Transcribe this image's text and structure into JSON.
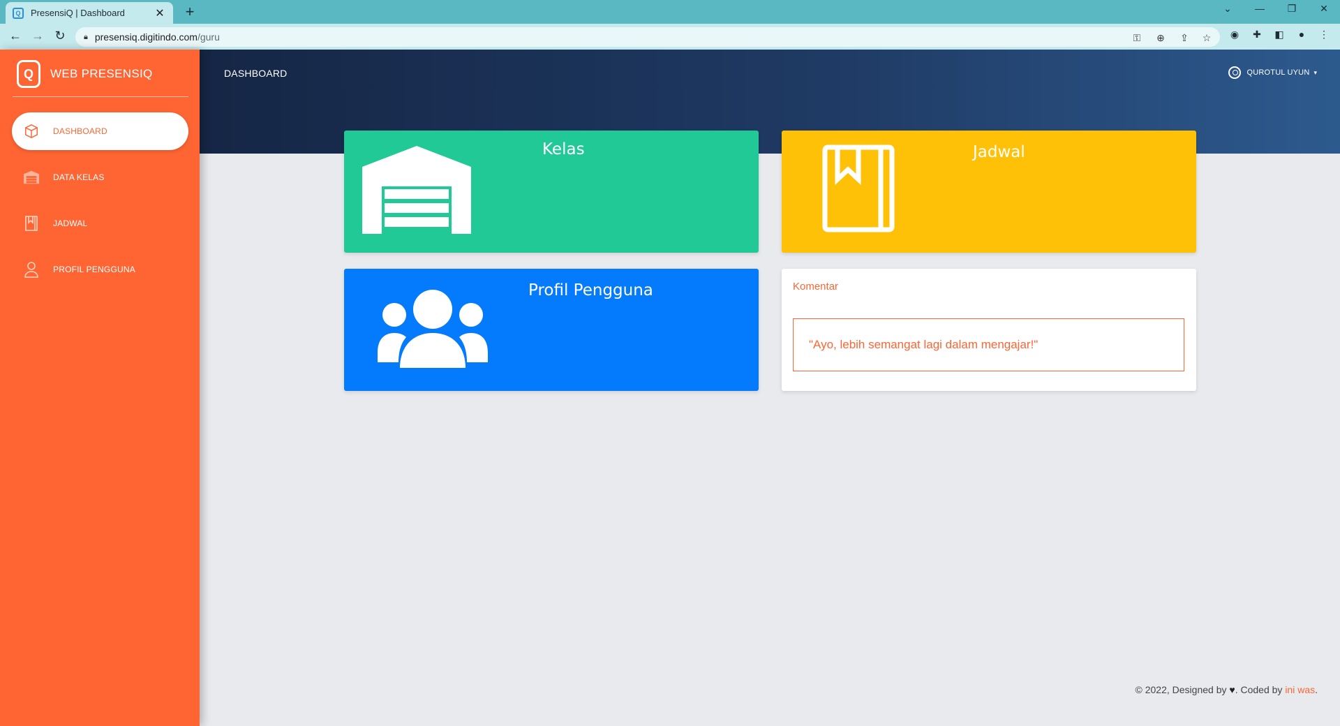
{
  "browser": {
    "tab_title": "PresensiQ | Dashboard",
    "tab_close": "✕",
    "new_tab": "+",
    "url_host": "presensiq.digitindo.com",
    "url_path": "/guru",
    "window_controls": [
      "⌄",
      "—",
      "❐",
      "✕"
    ]
  },
  "sidebar": {
    "brand": "WEB PRESENSIQ",
    "logo_glyph": "Q",
    "items": [
      {
        "label": "DASHBOARD",
        "icon": "box-icon",
        "active": true
      },
      {
        "label": "DATA KELAS",
        "icon": "warehouse-icon",
        "active": false
      },
      {
        "label": "JADWAL",
        "icon": "book-icon",
        "active": false
      },
      {
        "label": "PROFIL PENGGUNA",
        "icon": "user-icon",
        "active": false
      }
    ]
  },
  "header": {
    "title": "DASHBOARD",
    "user_name": "QUROTUL UYUN",
    "caret": "▾"
  },
  "cards": {
    "kelas": {
      "title": "Kelas",
      "color": "#21c997",
      "icon": "warehouse-icon"
    },
    "jadwal": {
      "title": "Jadwal",
      "color": "#ffc107",
      "icon": "book-icon"
    },
    "profil": {
      "title": "Profil Pengguna",
      "color": "#047afd",
      "icon": "users-icon"
    },
    "komentar": {
      "label": "Komentar",
      "text": "\"Ayo, lebih semangat lagi dalam mengajar!\""
    }
  },
  "footer": {
    "prefix": "© 2022, Designed by",
    "heart": "♥",
    "mid": ". Coded by",
    "coder": "ini was",
    "suffix": "."
  },
  "colors": {
    "accent": "#fe6533",
    "header_dark": "#152645",
    "header_light": "#2d5a8e",
    "background": "#e9eaee"
  }
}
